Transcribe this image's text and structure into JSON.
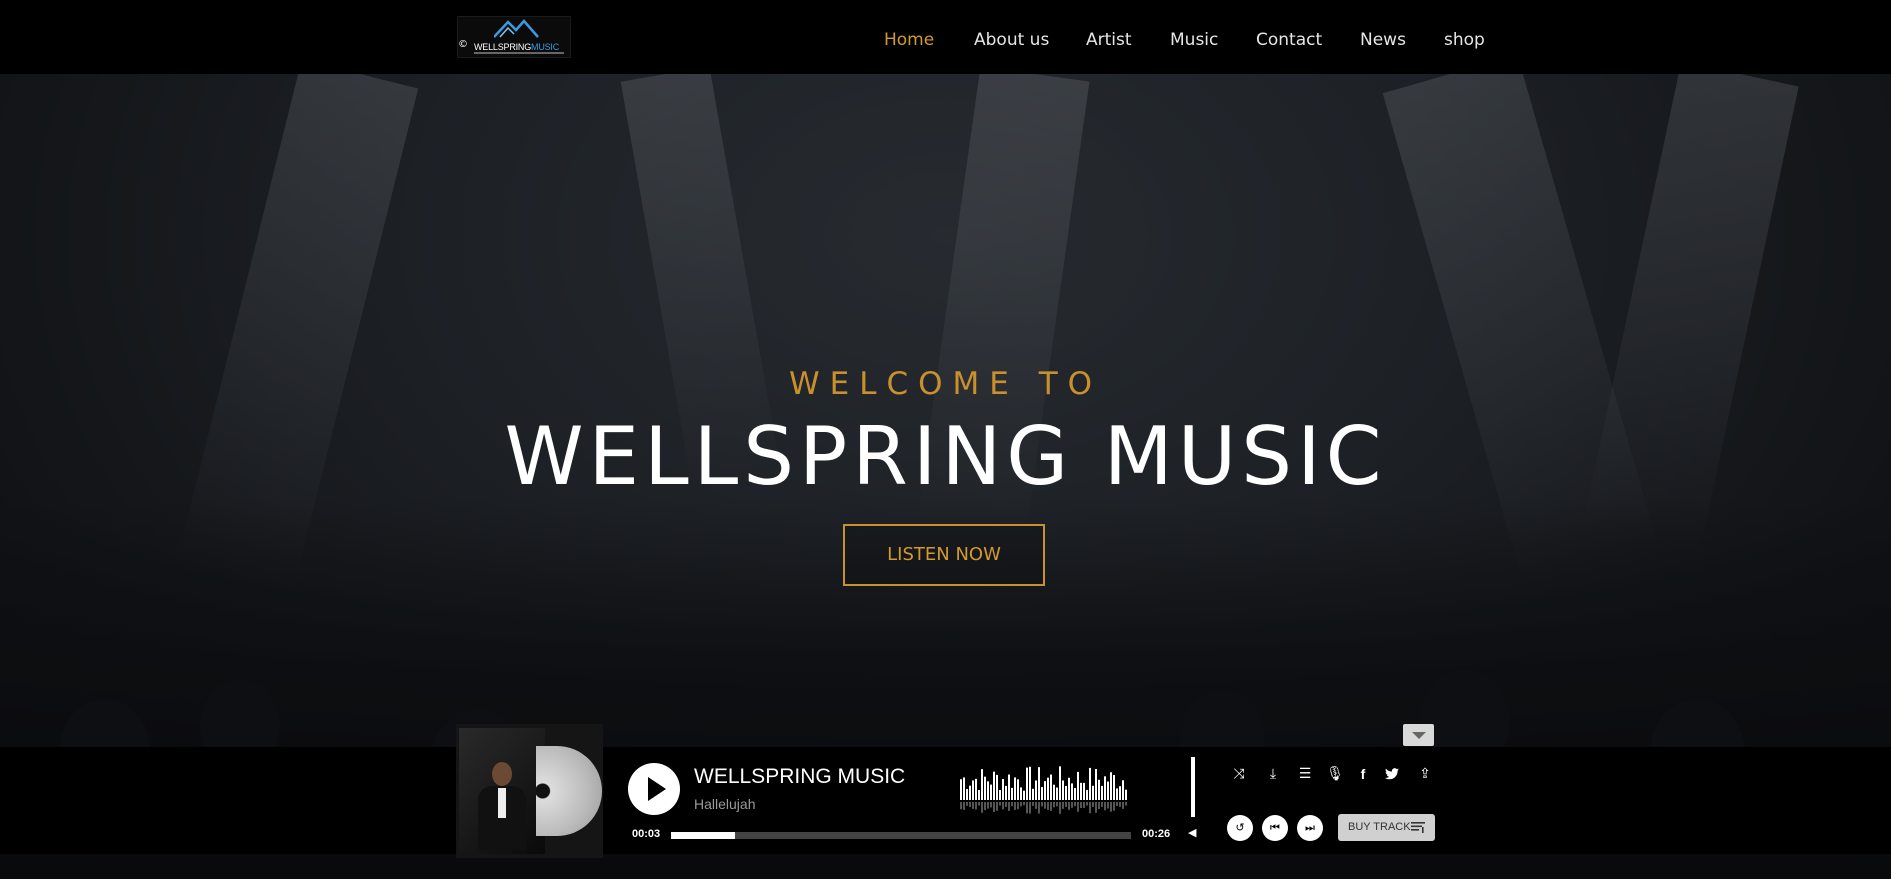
{
  "brand": {
    "copyright_symbol": "©",
    "name_part1": "WELLSPRING",
    "name_part2": "MUSIC"
  },
  "nav": {
    "items": [
      {
        "label": "Home",
        "active": true
      },
      {
        "label": "About us",
        "active": false
      },
      {
        "label": "Artist",
        "active": false
      },
      {
        "label": "Music",
        "active": false
      },
      {
        "label": "Contact",
        "active": false
      },
      {
        "label": "News",
        "active": false
      },
      {
        "label": "shop",
        "active": false
      }
    ]
  },
  "hero": {
    "eyebrow": "WELCOME TO",
    "title": "WELLSPRING MUSIC",
    "cta_label": "LISTEN NOW"
  },
  "player": {
    "track_title": "WELLSPRING MUSIC",
    "track_subtitle": "Hallelujah",
    "time_elapsed": "00:03",
    "time_total": "00:26",
    "progress_fraction": 0.14,
    "buy_label": "BUY TRACK",
    "icons": [
      "shuffle-icon",
      "download-icon",
      "playlist-icon",
      "microphone-icon",
      "facebook-icon",
      "twitter-icon",
      "share-icon"
    ],
    "controls": [
      "repeat-icon",
      "previous-icon",
      "next-icon"
    ]
  },
  "colors": {
    "accent": "#c9902b",
    "nav_active": "#d39a2c",
    "background": "#000000"
  }
}
